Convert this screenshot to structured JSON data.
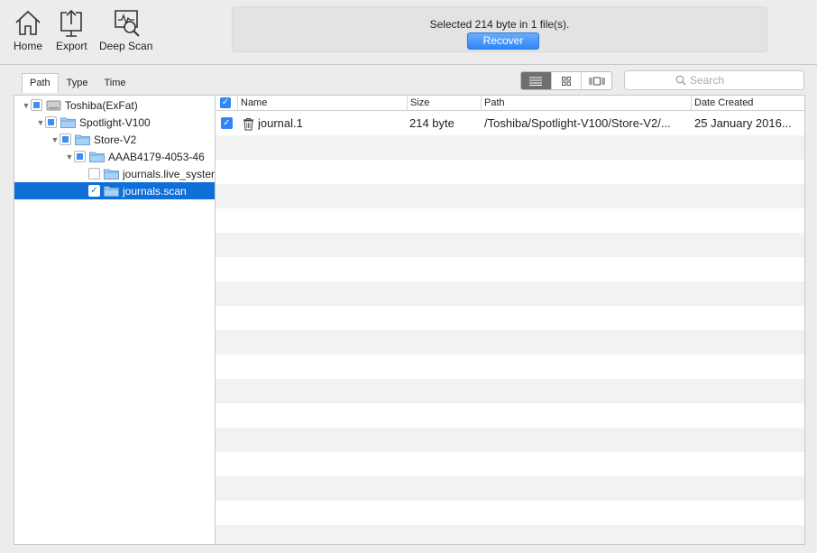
{
  "toolbar": {
    "home_label": "Home",
    "export_label": "Export",
    "deep_scan_label": "Deep Scan",
    "status_text": "Selected 214 byte in 1 file(s).",
    "recover_label": "Recover"
  },
  "tabs": [
    "Path",
    "Type",
    "Time"
  ],
  "search": {
    "placeholder": "Search"
  },
  "tree": [
    {
      "label": "Toshiba(ExFat)",
      "icon": "drive-icon"
    },
    {
      "label": "Spotlight-V100",
      "icon": "folder-icon"
    },
    {
      "label": "Store-V2",
      "icon": "folder-icon"
    },
    {
      "label": "AAAB4179-4053-46",
      "icon": "folder-icon"
    },
    {
      "label": "journals.live_syster",
      "icon": "folder-icon"
    },
    {
      "label": "journals.scan",
      "icon": "folder-icon"
    }
  ],
  "table": {
    "headers": {
      "name": "Name",
      "size": "Size",
      "path": "Path",
      "date": "Date Created"
    },
    "rows": [
      {
        "name": "journal.1",
        "size": "214 byte",
        "path": "/Toshiba/Spotlight-V100/Store-V2/...",
        "date": "25 January 2016..."
      }
    ]
  },
  "colors": {
    "accent": "#2f86f6",
    "selection": "#0f6fd9",
    "stripe": "#f2f2f2"
  }
}
